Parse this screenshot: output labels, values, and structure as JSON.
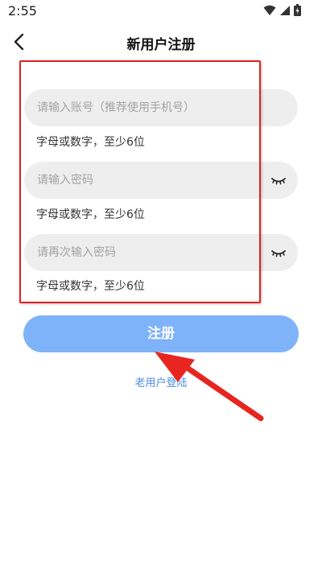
{
  "status_bar": {
    "time": "2:55",
    "icons": [
      "wifi-icon",
      "cellular-signal-icon",
      "battery-icon"
    ]
  },
  "header": {
    "title": "新用户注册",
    "back_icon": "chevron-left-icon"
  },
  "form": {
    "account": {
      "placeholder": "请输入账号（推荐使用手机号）",
      "value": "",
      "hint": "字母或数字，至少6位"
    },
    "password": {
      "placeholder": "请输入密码",
      "value": "",
      "hint": "字母或数字，至少6位",
      "toggle_icon": "eye-closed-icon"
    },
    "confirm_password": {
      "placeholder": "请再次输入密码",
      "value": "",
      "hint": "字母或数字，至少6位",
      "toggle_icon": "eye-closed-icon"
    }
  },
  "actions": {
    "register_label": "注册",
    "login_link_label": "老用户登陆"
  },
  "colors": {
    "primary_button": "#7fb3f9",
    "link": "#4a8de0",
    "field_background": "#eeeeee",
    "annotation": "#e02020"
  }
}
